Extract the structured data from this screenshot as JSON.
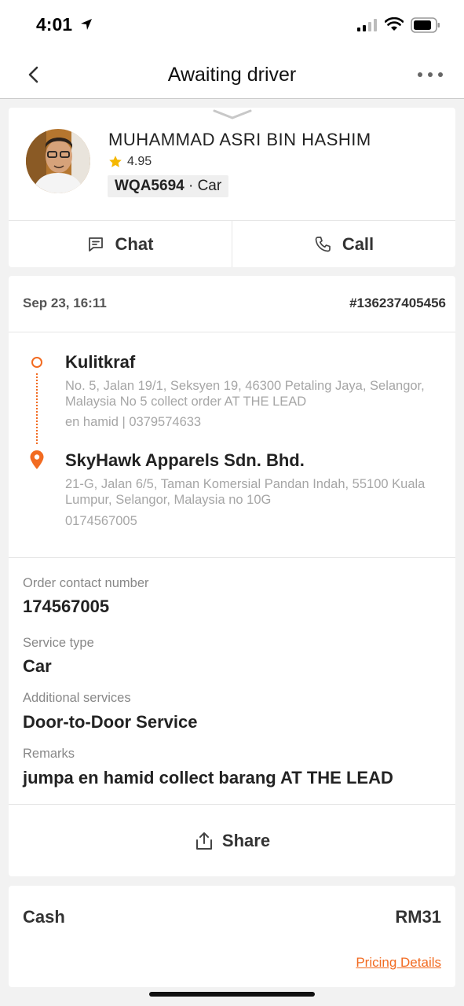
{
  "status_bar": {
    "time": "4:01"
  },
  "nav": {
    "title": "Awaiting driver"
  },
  "driver": {
    "name": "MUHAMMAD ASRI BIN HASHIM",
    "rating": "4.95",
    "plate": "WQA5694",
    "vehicle": "· Car",
    "chat_label": "Chat",
    "call_label": "Call"
  },
  "order": {
    "date": "Sep 23, 16:11",
    "id": "#136237405456",
    "pickup": {
      "name": "Kulitkraf",
      "address": "No. 5, Jalan 19/1, Seksyen 19, 46300 Petaling Jaya, Selangor, Malaysia No 5 collect order AT THE LEAD",
      "contact": "en hamid  |  0379574633"
    },
    "dropoff": {
      "name": "SkyHawk Apparels Sdn. Bhd.",
      "address": "21-G, Jalan 6/5, Taman Komersial Pandan Indah, 55100 Kuala Lumpur, Selangor, Malaysia no 10G",
      "contact": "0174567005"
    },
    "fields": [
      {
        "label": "Order contact number",
        "value": "174567005"
      },
      {
        "label": "Service type",
        "value": "Car"
      },
      {
        "label": "Additional services",
        "value": "Door-to-Door Service"
      },
      {
        "label": "Remarks",
        "value": "jumpa en hamid collect barang AT THE LEAD"
      }
    ],
    "share_label": "Share"
  },
  "payment": {
    "method": "Cash",
    "amount": "RM31",
    "pricing_link": "Pricing Details"
  },
  "colors": {
    "accent": "#f26b21",
    "star": "#f5b700"
  },
  "icons": [
    "location-arrow-icon",
    "signal-icon",
    "wifi-icon",
    "battery-icon",
    "back-chevron-icon",
    "more-dots-icon",
    "collapse-handle-icon",
    "star-icon",
    "chat-icon",
    "phone-icon",
    "origin-dot-icon",
    "destination-pin-icon",
    "share-icon"
  ]
}
